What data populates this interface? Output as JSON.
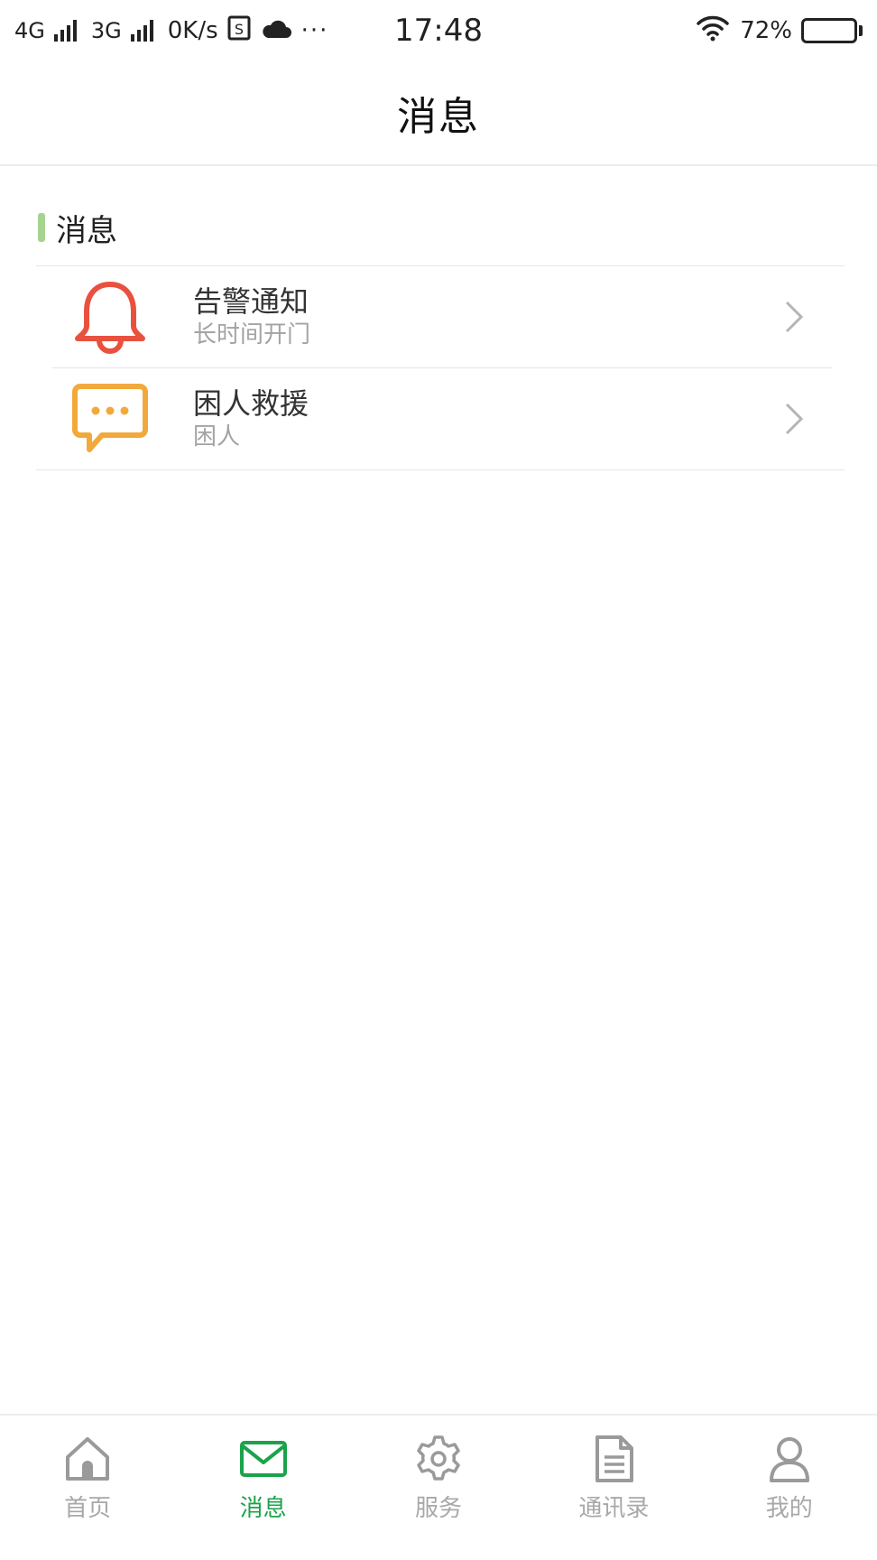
{
  "status_bar": {
    "network_1": "4G",
    "network_2": "3G",
    "speed": "0K/s",
    "time": "17:48",
    "battery": "72%",
    "battery_level": 0.72,
    "more": "···"
  },
  "header": {
    "title": "消息"
  },
  "section": {
    "title": "消息",
    "accent_color": "#a6d38f"
  },
  "messages": [
    {
      "title": "告警通知",
      "subtitle": "长时间开门",
      "icon": "bell-icon",
      "icon_color": "#e9513f"
    },
    {
      "title": "困人救援",
      "subtitle": "困人",
      "icon": "chat-bubble-icon",
      "icon_color": "#f2a93b"
    }
  ],
  "tabs": [
    {
      "label": "首页",
      "icon": "home-icon",
      "active": false
    },
    {
      "label": "消息",
      "icon": "mail-icon",
      "active": true
    },
    {
      "label": "服务",
      "icon": "gear-icon",
      "active": false
    },
    {
      "label": "通讯录",
      "icon": "document-icon",
      "active": false
    },
    {
      "label": "我的",
      "icon": "user-icon",
      "active": false
    }
  ],
  "colors": {
    "active_tab": "#1aa34a",
    "inactive_tab": "#a8a8a8"
  }
}
